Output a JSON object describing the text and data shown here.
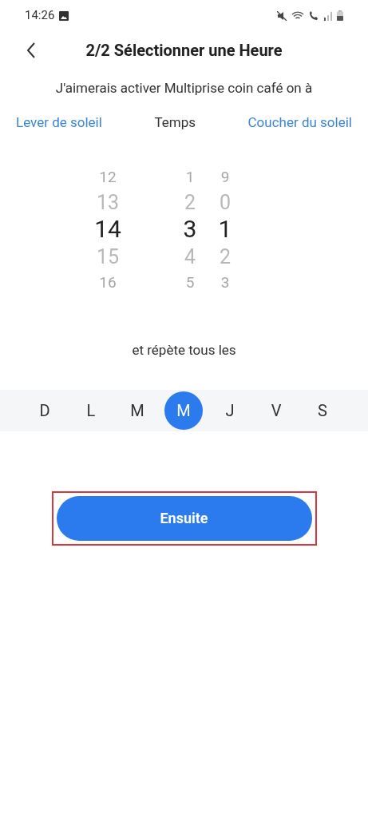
{
  "status_bar": {
    "time": "14:26"
  },
  "header": {
    "title": "2/2 Sélectionner une Heure"
  },
  "prompt": "J'aimerais activer Multiprise coin café on à",
  "modes": [
    {
      "label": "Lever de soleil",
      "selected": false
    },
    {
      "label": "Temps",
      "selected": true
    },
    {
      "label": "Coucher du soleil",
      "selected": false
    }
  ],
  "picker": {
    "columns": [
      {
        "items": [
          {
            "label": "12",
            "selected": false
          },
          {
            "label": "13",
            "selected": false
          },
          {
            "label": "14",
            "selected": true
          },
          {
            "label": "15",
            "selected": false
          },
          {
            "label": "16",
            "selected": false
          }
        ]
      },
      {
        "items": [
          {
            "label": "1",
            "selected": false
          },
          {
            "label": "2",
            "selected": false
          },
          {
            "label": "3",
            "selected": true
          },
          {
            "label": "4",
            "selected": false
          },
          {
            "label": "5",
            "selected": false
          }
        ]
      },
      {
        "items": [
          {
            "label": "9",
            "selected": false
          },
          {
            "label": "0",
            "selected": false
          },
          {
            "label": "1",
            "selected": true
          },
          {
            "label": "2",
            "selected": false
          },
          {
            "label": "3",
            "selected": false
          }
        ]
      }
    ]
  },
  "repeat_label": "et répète tous les",
  "days": [
    {
      "label": "D",
      "selected": false
    },
    {
      "label": "L",
      "selected": false
    },
    {
      "label": "M",
      "selected": false
    },
    {
      "label": "M",
      "selected": true
    },
    {
      "label": "J",
      "selected": false
    },
    {
      "label": "V",
      "selected": false
    },
    {
      "label": "S",
      "selected": false
    }
  ],
  "next_button": {
    "label": "Ensuite",
    "highlighted": true
  }
}
